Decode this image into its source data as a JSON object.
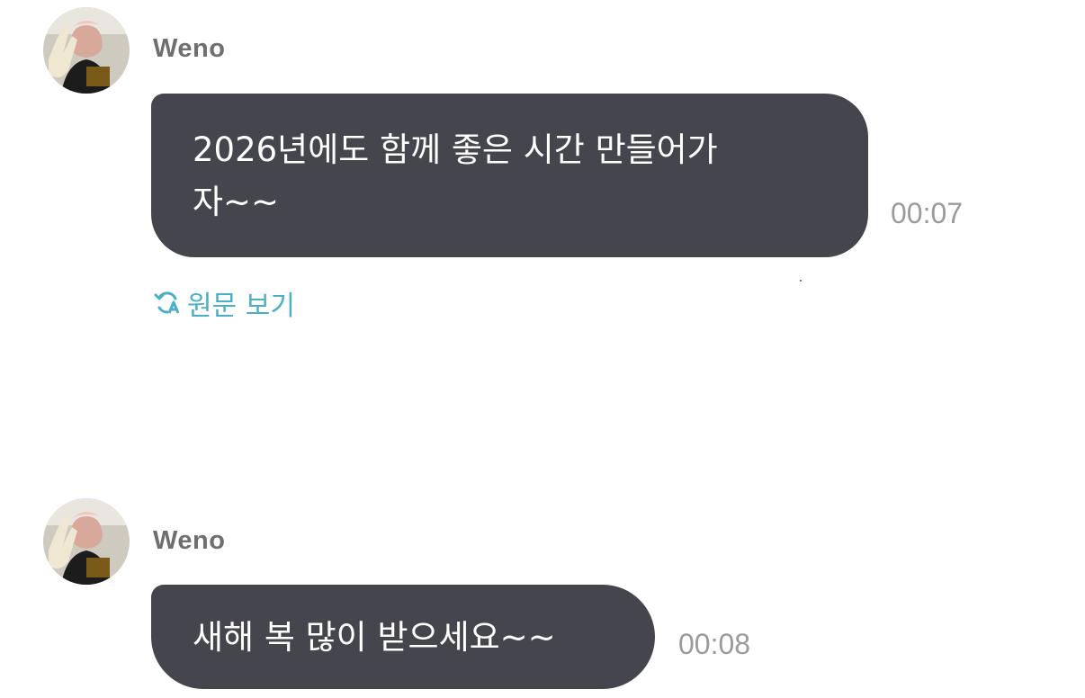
{
  "messages": [
    {
      "sender": "Weno",
      "text": "2026년에도 함께 좋은 시간 만들어가 자~~",
      "text_lines": [
        "2026년에도 함께 좋은 시간 만들어가",
        "자~~"
      ],
      "time": "00:07",
      "translate_action": {
        "label": "원문 보기",
        "icon": "translate-refresh-icon"
      }
    },
    {
      "sender": "Weno",
      "text": "새해 복 많이 받으세요~~",
      "time": "00:08"
    }
  ],
  "colors": {
    "bubble": "#45464d",
    "bubble_text": "#ffffff",
    "sender_name": "#6f6f6f",
    "timestamp": "#9b9b9b",
    "translate_link": "#4ab0c4"
  }
}
